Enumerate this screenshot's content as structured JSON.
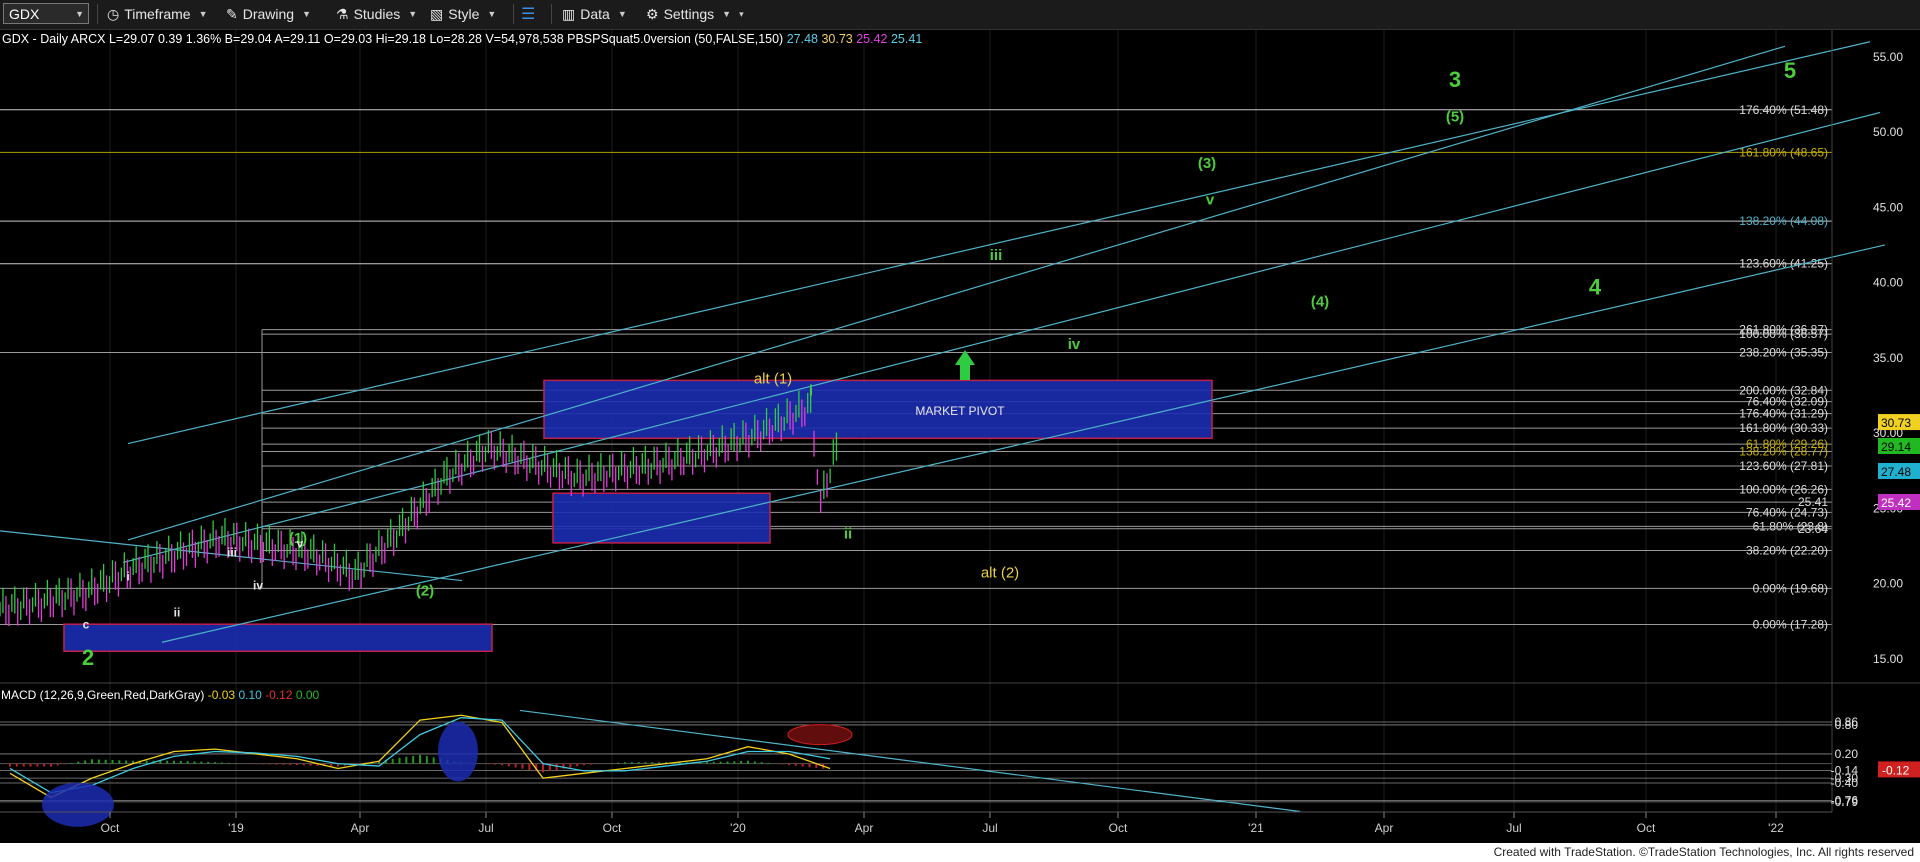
{
  "toolbar": {
    "symbol": "GDX",
    "items": [
      "Timeframe",
      "Drawing",
      "Studies",
      "Style",
      "Data",
      "Settings"
    ]
  },
  "info_line": {
    "parts": [
      {
        "text": "GDX - Daily  ARCX  L=29.07  0.39  1.36%  B=29.04  A=29.11  O=29.03  Hi=29.18  Lo=28.28  V=54,978,538  PBSPSquat5.0version (50,FALSE,150)",
        "color": "#ffffff"
      },
      {
        "text": "27.48",
        "color": "#5ccfe6"
      },
      {
        "text": "30.73",
        "color": "#f0d060"
      },
      {
        "text": "25.42",
        "color": "#e040e0"
      },
      {
        "text": "25.41",
        "color": "#5ccfe6"
      }
    ]
  },
  "colors": {
    "up": "#2ecc40",
    "down": "#e23cd8",
    "channel": "#4fb3c8",
    "box": "#1b2cb0",
    "box_border": "#c0204a",
    "wave_green": "#4ccd3a",
    "wave_yellow": "#e8d04a"
  },
  "chart_data": [
    {
      "type": "line",
      "title": "GDX - Daily",
      "x_ticks": [
        "Oct",
        "'19",
        "Apr",
        "Jul",
        "Oct",
        "'20",
        "Apr",
        "Jul",
        "Oct",
        "'21",
        "Apr",
        "Jul",
        "Oct",
        "'22"
      ],
      "ylim": [
        13.5,
        57
      ],
      "y_ticks": [
        15,
        20,
        25,
        30,
        35,
        40,
        45,
        50,
        55
      ],
      "x": [
        "2018-08",
        "2018-09",
        "2018-10",
        "2018-11",
        "2018-12",
        "2019-01",
        "2019-02",
        "2019-03",
        "2019-04",
        "2019-05",
        "2019-06",
        "2019-07",
        "2019-08",
        "2019-09",
        "2019-10",
        "2019-11",
        "2019-12",
        "2020-01",
        "2020-02",
        "2020-03-09",
        "2020-03-16",
        "2020-03-27"
      ],
      "price": [
        21.9,
        18.3,
        18.8,
        19.5,
        21.0,
        22.0,
        23.0,
        22.5,
        22.0,
        20.6,
        23.5,
        27.0,
        29.0,
        28.0,
        27.0,
        27.5,
        28.0,
        28.8,
        29.8,
        31.8,
        25.3,
        29.1
      ],
      "fib_levels": [
        {
          "label": "176.40% (51.48)",
          "value": 51.48
        },
        {
          "label": "161.80% (48.65)",
          "value": 48.65
        },
        {
          "label": "138.20% (44.08)",
          "value": 44.08
        },
        {
          "label": "123.60% (41.25)",
          "value": 41.25
        },
        {
          "label": "261.80% (36.87)",
          "value": 36.87
        },
        {
          "label": "100.00% (36.57)",
          "value": 36.57
        },
        {
          "label": "238.20% (35.35)",
          "value": 35.35
        },
        {
          "label": "200.00% (32.84)",
          "value": 32.84
        },
        {
          "label": "76.40% (32.09)",
          "value": 32.09
        },
        {
          "label": "176.40% (31.29)",
          "value": 31.29
        },
        {
          "label": "161.80% (30.33)",
          "value": 30.33
        },
        {
          "label": "61.80% (29.26)",
          "value": 29.26
        },
        {
          "label": "138.20% (28.77)",
          "value": 28.77
        },
        {
          "label": "123.60% (27.81)",
          "value": 27.81
        },
        {
          "label": "100.00% (26.26)",
          "value": 26.26
        },
        {
          "label": "25.41",
          "value": 25.41
        },
        {
          "label": "76.40% (24.73)",
          "value": 24.73
        },
        {
          "label": "61.80% (23.8)",
          "value": 23.8
        },
        {
          "label": "23.64",
          "value": 23.64
        },
        {
          "label": "38.20% (22.20)",
          "value": 22.2
        },
        {
          "label": "0.00% (19.68)",
          "value": 19.68
        },
        {
          "label": "0.00% (17.28)",
          "value": 17.28
        }
      ],
      "price_tags": [
        {
          "text": "30.73",
          "value": 30.73,
          "bg": "#f0d020",
          "fg": "#000000"
        },
        {
          "text": "29.14",
          "value": 29.14,
          "bg": "#22b822",
          "fg": "#000000"
        },
        {
          "text": "27.48",
          "value": 27.48,
          "bg": "#20b0d0",
          "fg": "#000000"
        },
        {
          "text": "25.42",
          "value": 25.42,
          "bg": "#c030c0",
          "fg": "#ffffff"
        }
      ],
      "box_text": "MARKET PIVOT",
      "wave_labels": [
        {
          "text": "5",
          "color": "green",
          "big": true
        },
        {
          "text": "3",
          "color": "green",
          "big": true
        },
        {
          "text": "(5)",
          "color": "green"
        },
        {
          "text": "(3)",
          "color": "green"
        },
        {
          "text": "v",
          "color": "green"
        },
        {
          "text": "iii",
          "color": "green"
        },
        {
          "text": "(4)",
          "color": "green"
        },
        {
          "text": "4",
          "color": "green",
          "big": true
        },
        {
          "text": "iv",
          "color": "green"
        },
        {
          "text": "alt (1)",
          "color": "yellow"
        },
        {
          "text": "i",
          "color": "green"
        },
        {
          "text": "ii",
          "color": "green"
        },
        {
          "text": "alt (2)",
          "color": "yellow"
        },
        {
          "text": "(1)",
          "color": "green"
        },
        {
          "text": "v",
          "color": "white"
        },
        {
          "text": "iii",
          "color": "white"
        },
        {
          "text": "iv",
          "color": "white"
        },
        {
          "text": "i",
          "color": "white"
        },
        {
          "text": "ii",
          "color": "white"
        },
        {
          "text": "(2)",
          "color": "green"
        },
        {
          "text": "c",
          "color": "white"
        },
        {
          "text": "2",
          "color": "green",
          "big": true
        }
      ]
    },
    {
      "type": "line",
      "title": "MACD (12,26,9,Green,Red,DarkGray)",
      "legend_values": [
        "-0.03",
        "0.10",
        "-0.12",
        "0.00"
      ],
      "ylim": [
        -1.0,
        1.15
      ],
      "y_ticks": [
        0.86,
        0.8,
        0.2,
        -0.14,
        -0.3,
        -0.4,
        -0.76,
        -0.79
      ],
      "y_tick_labels": [
        "0.86",
        "0.80",
        "0.20",
        "-0.14",
        "-0.30",
        "-0.40",
        "-0.76",
        "-0.79"
      ],
      "tag": {
        "text": "-0.12",
        "value": -0.12,
        "bg": "#d02020",
        "fg": "#ffffff"
      },
      "series": [
        {
          "values": [
            -0.2,
            -0.7,
            -0.3,
            0.0,
            0.25,
            0.3,
            0.2,
            0.1,
            -0.1,
            0.05,
            0.9,
            1.0,
            0.85,
            -0.3,
            -0.2,
            -0.1,
            0.0,
            0.1,
            0.35,
            0.2,
            -0.1
          ]
        },
        {
          "values": [
            -0.1,
            -0.6,
            -0.45,
            -0.1,
            0.15,
            0.25,
            0.22,
            0.15,
            0.0,
            -0.05,
            0.6,
            0.95,
            0.9,
            0.0,
            -0.15,
            -0.15,
            -0.05,
            0.05,
            0.25,
            0.25,
            0.1
          ]
        }
      ]
    }
  ],
  "footer": "Created with TradeStation. ©TradeStation Technologies, Inc. All rights reserved"
}
